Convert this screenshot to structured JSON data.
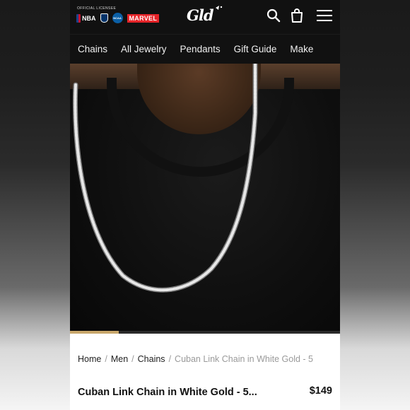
{
  "header": {
    "licensee_text": "OFFICIAL LICENSEE",
    "partners": [
      "NBA",
      "NFL",
      "NCAA",
      "MARVEL"
    ],
    "logo_text": "GLD",
    "icons": [
      "search-icon",
      "bag-icon",
      "menu-icon"
    ]
  },
  "nav": {
    "items": [
      "Chains",
      "All Jewelry",
      "Pendants",
      "Gift Guide",
      "Make"
    ]
  },
  "hero": {
    "image_alt": "Man wearing black t-shirt with silver Cuban link chain",
    "carousel_progress": 0.18
  },
  "breadcrumb": {
    "items": [
      "Home",
      "Men",
      "Chains"
    ],
    "current": "Cuban Link Chain in White Gold - 5"
  },
  "product": {
    "title": "Cuban Link Chain in White Gold - 5...",
    "price": "$149"
  },
  "colors": {
    "header_bg": "#111111",
    "accent_gold": "#c8a66a",
    "nba_blue": "#1d428a",
    "marvel_red": "#e62429"
  }
}
